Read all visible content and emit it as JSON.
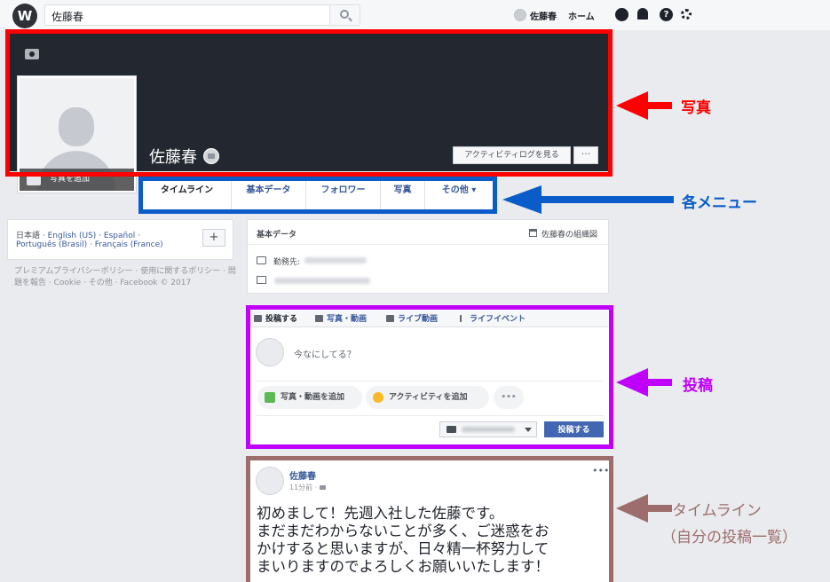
{
  "topbar": {
    "logo": "W",
    "search_value": "佐藤春",
    "user_name": "佐藤春",
    "home_label": "ホーム",
    "help_glyph": "?"
  },
  "cover": {
    "name": "佐藤春",
    "activity_log_button": "アクティビティログを見る",
    "more_button": "···",
    "add_photo_label": "写真を追加"
  },
  "tabs": [
    {
      "label": "タイムライン",
      "active": true
    },
    {
      "label": "基本データ"
    },
    {
      "label": "フォロワー"
    },
    {
      "label": "写真"
    },
    {
      "label": "その他 ▾"
    }
  ],
  "languages": {
    "line1": [
      "日本語",
      "English (US)",
      "Español"
    ],
    "line2": [
      "Português (Brasil)",
      "Français (France)"
    ],
    "separator": " · ",
    "add_button": "+"
  },
  "footer": {
    "text": "プレミアムプライバシーポリシー · 使用に関するポリシー · 問題を報告 · Cookie · その他 · Facebook © 2017"
  },
  "basic_data": {
    "title": "基本データ",
    "org_chart_link": "佐藤春の組織図",
    "work_label": "勤務先:"
  },
  "composer": {
    "tabs": [
      "投稿する",
      "写真・動画",
      "ライブ動画",
      "ライフイベント"
    ],
    "placeholder": "今なにしてる？",
    "add_photo_button": "写真・動画を追加",
    "add_activity_button": "アクティビティを追加",
    "more_button": "•••",
    "post_button": "投稿する"
  },
  "timeline_post": {
    "author": "佐藤春",
    "time": "11分前 · ",
    "more": "•••",
    "lines": [
      "初めまして！先週入社した佐藤です。",
      "まだまだわからないことが多く、ご迷惑をお",
      "かけすると思いますが、日々精一杯努力して",
      "まいりますのでよろしくお願いいたします！"
    ]
  },
  "annotations": {
    "photo": "写真",
    "menu": "各メニュー",
    "post": "投稿",
    "timeline": "タイムライン",
    "timeline_sub": "（自分の投稿一覧）"
  },
  "colors": {
    "red": "#ff0000",
    "blue": "#0a5dc9",
    "purple": "#c000ff",
    "brown": "#9d6d6d",
    "link": "#365899",
    "post_button": "#4267b2"
  }
}
